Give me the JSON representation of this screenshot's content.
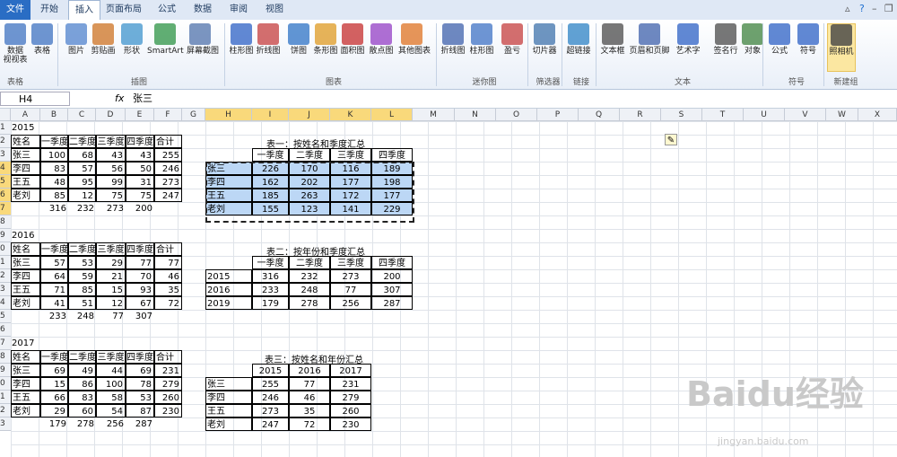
{
  "ribbon": {
    "tabs": [
      "文件",
      "开始",
      "插入",
      "页面布局",
      "公式",
      "数据",
      "审阅",
      "视图"
    ],
    "active_tab": "插入",
    "buttons": [
      "数据\n视视表",
      "表格",
      "图片",
      "剪贴画",
      "形状",
      "SmartArt",
      "屏幕截图",
      "柱形图",
      "折线图",
      "饼图",
      "条形图",
      "面积图",
      "散点图",
      "其他图表",
      "折线图",
      "柱形图",
      "盈亏",
      "切片器",
      "超链接",
      "文本框",
      "页眉和页脚",
      "艺术字",
      "签名行",
      "对象",
      "公式",
      "符号",
      "照相机"
    ],
    "groups": [
      "表格",
      "插图",
      "图表",
      "迷你图",
      "筛选器",
      "链接",
      "文本",
      "符号",
      "新建组"
    ]
  },
  "formula_bar": {
    "name_box": "H4",
    "fx": "fx",
    "value": "张三"
  },
  "columns": [
    "A",
    "B",
    "C",
    "D",
    "E",
    "F",
    "G",
    "H",
    "I",
    "J",
    "K",
    "L",
    "M",
    "N",
    "O",
    "P",
    "Q",
    "R",
    "S",
    "T",
    "U",
    "V",
    "W",
    "X"
  ],
  "rows": [
    "1",
    "2",
    "3",
    "4",
    "5",
    "6",
    "7",
    "8",
    "9",
    "0",
    "1",
    "2",
    "3",
    "4",
    "5",
    "6",
    "7",
    "8",
    "9",
    "0",
    "1",
    "2",
    "3"
  ],
  "year2015": {
    "year": "2015",
    "headers": [
      "姓名",
      "一季度",
      "二季度",
      "三季度",
      "四季度",
      "合计"
    ],
    "rows": [
      [
        "张三",
        "100",
        "68",
        "43",
        "43",
        "255"
      ],
      [
        "李四",
        "83",
        "57",
        "56",
        "50",
        "246"
      ],
      [
        "王五",
        "48",
        "95",
        "99",
        "31",
        "273"
      ],
      [
        "老刘",
        "85",
        "12",
        "75",
        "75",
        "247"
      ]
    ],
    "totals": [
      "316",
      "232",
      "273",
      "200"
    ]
  },
  "year2016": {
    "year": "2016",
    "headers": [
      "姓名",
      "一季度",
      "二季度",
      "三季度",
      "四季度",
      "合计"
    ],
    "rows": [
      [
        "张三",
        "57",
        "53",
        "29",
        "77",
        "77"
      ],
      [
        "李四",
        "64",
        "59",
        "21",
        "70",
        "46"
      ],
      [
        "王五",
        "71",
        "85",
        "15",
        "93",
        "35"
      ],
      [
        "老刘",
        "41",
        "51",
        "12",
        "67",
        "72"
      ]
    ],
    "totals": [
      "233",
      "248",
      "77",
      "307"
    ]
  },
  "year2017": {
    "year": "2017",
    "headers": [
      "姓名",
      "一季度",
      "二季度",
      "三季度",
      "四季度",
      "合计"
    ],
    "rows": [
      [
        "张三",
        "69",
        "49",
        "44",
        "69",
        "231"
      ],
      [
        "李四",
        "15",
        "86",
        "100",
        "78",
        "279"
      ],
      [
        "王五",
        "66",
        "83",
        "58",
        "53",
        "260"
      ],
      [
        "老刘",
        "29",
        "60",
        "54",
        "87",
        "230"
      ]
    ],
    "totals": [
      "179",
      "278",
      "256",
      "287"
    ]
  },
  "table1": {
    "title": "表一：按姓名和季度汇总",
    "headers": [
      "一季度",
      "二季度",
      "三季度",
      "四季度"
    ],
    "rows": [
      [
        "张三",
        "226",
        "170",
        "116",
        "189"
      ],
      [
        "李四",
        "162",
        "202",
        "177",
        "198"
      ],
      [
        "王五",
        "185",
        "263",
        "172",
        "177"
      ],
      [
        "老刘",
        "155",
        "123",
        "141",
        "229"
      ]
    ]
  },
  "table2": {
    "title": "表二：按年份和季度汇总",
    "headers": [
      "一季度",
      "二季度",
      "三季度",
      "四季度"
    ],
    "rows": [
      [
        "2015",
        "316",
        "232",
        "273",
        "200"
      ],
      [
        "2016",
        "233",
        "248",
        "77",
        "307"
      ],
      [
        "2019",
        "179",
        "278",
        "256",
        "287"
      ]
    ]
  },
  "table3": {
    "title": "表三：按姓名和年份汇总",
    "headers": [
      "2015",
      "2016",
      "2017"
    ],
    "rows": [
      [
        "张三",
        "255",
        "77",
        "231"
      ],
      [
        "李四",
        "246",
        "46",
        "279"
      ],
      [
        "王五",
        "273",
        "35",
        "260"
      ],
      [
        "老刘",
        "247",
        "72",
        "230"
      ]
    ]
  },
  "watermark": {
    "main": "Baidu经验",
    "sub": "jingyan.baidu.com"
  }
}
